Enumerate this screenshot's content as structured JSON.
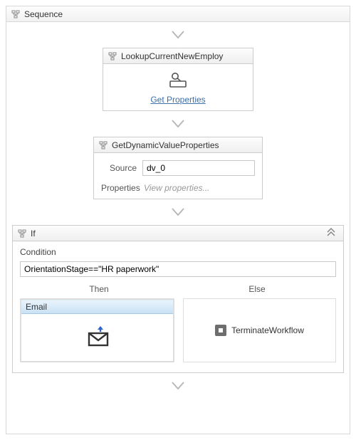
{
  "sequence": {
    "title": "Sequence"
  },
  "lookup": {
    "title": "LookupCurrentNewEmploy",
    "get_properties_label": "Get Properties"
  },
  "dynprops": {
    "title": "GetDynamicValueProperties",
    "source_label": "Source",
    "source_value": "dv_0",
    "properties_label": "Properties",
    "properties_hint": "View properties..."
  },
  "if": {
    "title": "If",
    "condition_label": "Condition",
    "condition_value": "OrientationStage==\"HR paperwork\"",
    "then_label": "Then",
    "else_label": "Else",
    "email_title": "Email",
    "terminate_label": "TerminateWorkflow"
  }
}
